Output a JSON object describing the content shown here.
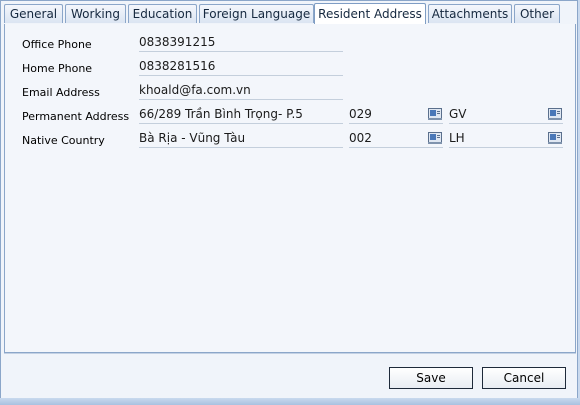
{
  "tabs": [
    {
      "label": "General",
      "active": false
    },
    {
      "label": "Working",
      "active": false
    },
    {
      "label": "Education",
      "active": false
    },
    {
      "label": "Foreign Language",
      "active": false
    },
    {
      "label": "Resident Address",
      "active": true
    },
    {
      "label": "Attachments",
      "active": false
    },
    {
      "label": "Other",
      "active": false
    }
  ],
  "form": {
    "office_phone": {
      "label": "Office Phone",
      "value": "0838391215"
    },
    "home_phone": {
      "label": "Home Phone",
      "value": "0838281516"
    },
    "email": {
      "label": "Email Address",
      "value": "khoald@fa.com.vn"
    },
    "permanent_address": {
      "label": "Permanent Address",
      "value": "66/289 Trần Bình Trọng- P.5",
      "code1": "029",
      "code2": "GV"
    },
    "native_country": {
      "label": "Native Country",
      "value": "Bà Rịa - Vũng Tàu",
      "code1": "002",
      "code2": "LH"
    }
  },
  "buttons": {
    "save": "Save",
    "cancel": "Cancel"
  },
  "icons": {
    "lookup": "lookup-picker-icon"
  }
}
